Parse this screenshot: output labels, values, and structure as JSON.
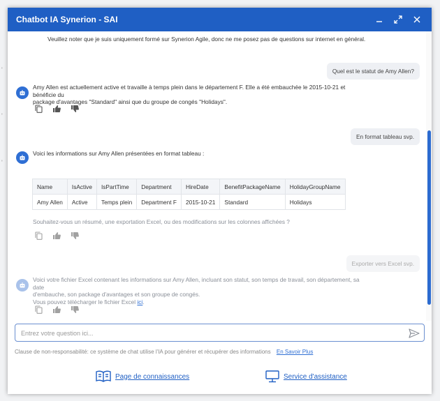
{
  "window": {
    "title": "Chatbot IA Synerion - SAI"
  },
  "chat": {
    "top_note": "Veuillez noter que je suis uniquement formé sur Synerion Agile, donc ne me posez pas de questions sur internet en général.",
    "msg1_user": "Quel est le statut de Amy Allen?",
    "msg1_bot_line1": "Amy Allen est actuellement active et travaille à temps plein dans le département F. Elle a été embauchée le 2015-10-21 et bénéficie du",
    "msg1_bot_line2": "package d'avantages \"Standard\" ainsi que du groupe de congés \"Holidays\".",
    "msg2_user": "En format tableau svp.",
    "msg2_bot_intro": "Voici les informations sur Amy Allen présentées en format tableau :",
    "table": {
      "headers": [
        "Name",
        "IsActive",
        "IsPartTime",
        "Department",
        "HireDate",
        "BenefitPackageName",
        "HolidayGroupName"
      ],
      "row": [
        "Amy Allen",
        "Active",
        "Temps plein",
        "Department F",
        "2015-10-21",
        "Standard",
        "Holidays"
      ]
    },
    "msg2_bot_followup": "Souhaitez-vous un résumé, une exportation Excel, ou des modifications sur les colonnes affichées ?",
    "msg3_user": "Exporter vers Excel svp.",
    "msg3_bot_line1": "Voici votre fichier Excel contenant les informations sur Amy Allen, incluant son statut, son temps de travail, son département, sa date",
    "msg3_bot_line2": "d'embauche, son package d'avantages et son groupe de congés.",
    "msg3_bot_line3": "Vous pouvez télécharger le fichier Excel",
    "msg3_bot_link": "ici",
    "msg3_bot_link_tail": "."
  },
  "input": {
    "placeholder": "Entrez votre question ici..."
  },
  "disclaimer": {
    "text": "Clause de non-responsabilité: ce système de chat utilise l'IA pour générer et récupérer des informations",
    "link": "En Savoir Plus"
  },
  "footer": {
    "knowledge": "Page de connaissances",
    "support": "Service d'assistance"
  },
  "colors": {
    "accent": "#1f5fc4",
    "bubble": "#eef0f4"
  }
}
